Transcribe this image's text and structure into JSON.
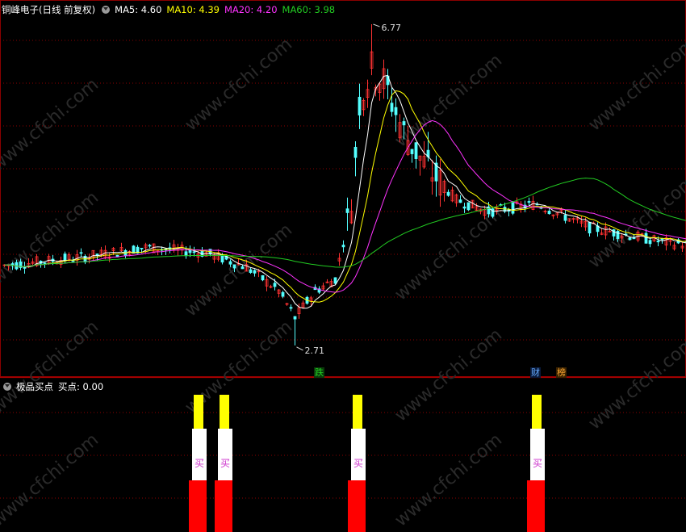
{
  "top_panel": {
    "stock_title": "铜峰电子",
    "period": "(日线 前复权)",
    "indicators": [
      {
        "label": "MA5: 4.60",
        "color": "#ffffff"
      },
      {
        "label": "MA10: 4.39",
        "color": "#ffff00"
      },
      {
        "label": "MA20: 4.20",
        "color": "#ff33ff"
      },
      {
        "label": "MA60: 3.98",
        "color": "#22cc22"
      }
    ],
    "high_label": "6.77",
    "low_label": "2.71",
    "event_badges": [
      {
        "text": "跌",
        "color": "#22cc22",
        "bg": "#0a3a0a"
      },
      {
        "text": "财",
        "color": "#66aaff",
        "bg": "#0a1a3a"
      },
      {
        "text": "榜",
        "color": "#ffaa33",
        "bg": "#3a2200"
      }
    ]
  },
  "bottom_panel": {
    "title": "极品买点",
    "value_label": "买点: 0.00",
    "bar_label": "买"
  },
  "watermark": "www.cfchi.com",
  "colors": {
    "up": "#ff3232",
    "down": "#54ffff",
    "grid": "#8b0000"
  },
  "chart_data": [
    {
      "type": "candlestick",
      "title": "铜峰电子",
      "ylim": [
        2.6,
        6.9
      ],
      "annotations": [
        {
          "label": "6.77",
          "value": 6.77
        },
        {
          "label": "2.71",
          "value": 2.71
        }
      ],
      "series": [
        {
          "name": "MA5: 4.60"
        },
        {
          "name": "MA10: 4.39"
        },
        {
          "name": "MA20: 4.20"
        },
        {
          "name": "MA60: 3.98"
        }
      ]
    },
    {
      "type": "bar",
      "title": "极品买点",
      "series": [
        {
          "name": "买点: 0.00"
        }
      ],
      "values": [
        1,
        1,
        1,
        1
      ]
    }
  ]
}
